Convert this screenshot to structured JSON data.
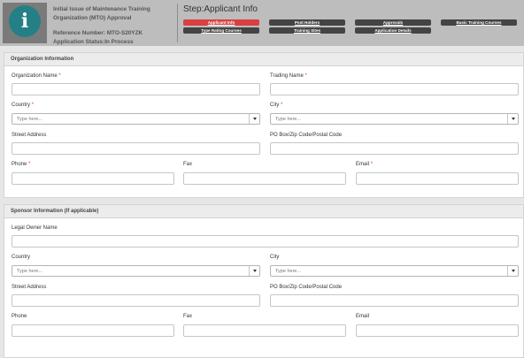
{
  "header": {
    "title_line1": "Initial Issue of Maintenance Training",
    "title_line2": "Organization (MTO) Approval",
    "reference": "Reference Number: MTO-S20YZK",
    "status": "Application Status:In Process",
    "step_title": "Step:Applicant Info",
    "tabs": {
      "applicant_info": "Applicant Info",
      "post_holders": "Post Holders",
      "approvals": "Approvals",
      "basic_training": "Basic Training Courses",
      "type_rating": "Type Rating Courses",
      "training_sites": "Training Sites",
      "application_details": "Application Details"
    },
    "colors": {
      "header_bg": "#bdbdbd",
      "icon_bg": "#247f86",
      "active_tab": "#d9403f",
      "tab": "#444444"
    }
  },
  "organization": {
    "heading": "Organization Information",
    "org_name_label": "Organization Name",
    "trading_name_label": "Trading Name",
    "country_label": "Country",
    "city_label": "City",
    "country_placeholder": "Type here...",
    "city_placeholder": "Type here...",
    "street_label": "Street Address",
    "po_box_label": "PO Box/Zip Code/Postal Code",
    "phone_label": "Phone",
    "fax_label": "Fax",
    "email_label": "Email",
    "required_marker": "*"
  },
  "sponsor": {
    "heading": "Sponsor Information (If applicable)",
    "owner_label": "Legal Owner Name",
    "country_label": "Country",
    "city_label": "City",
    "country_placeholder": "Type here...",
    "city_placeholder": "Type here...",
    "street_label": "Street Address",
    "po_box_label": "PO Box/Zip Code/Postal Code",
    "phone_label": "Phone",
    "fax_label": "Fax",
    "email_label": "Email"
  }
}
